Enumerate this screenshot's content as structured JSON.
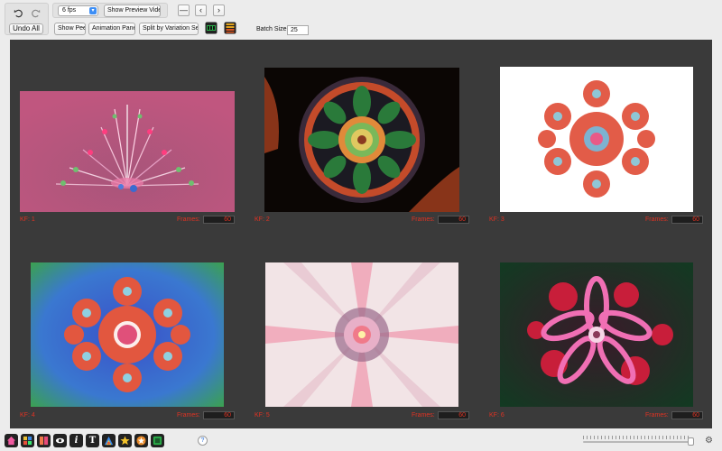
{
  "toolbar": {
    "undo_all_label": "Undo All",
    "fps_value": "6 fps",
    "show_preview_label": "Show Preview Video",
    "show_peer_label": "Show Peer",
    "animation_panel_label": "Animation Panel",
    "split_label": "Split by Variation Set",
    "batch_size_label": "Batch Size:",
    "batch_size_value": "25",
    "minus_glyph": "—",
    "prev_glyph": "‹",
    "next_glyph": "›",
    "icons": [
      "undo-icon",
      "redo-icon",
      "film-strip-icon",
      "film-stack-icon"
    ]
  },
  "keyframes": [
    {
      "kf_label": "KF: 1",
      "frames_label": "Frames:",
      "frames_value": "60",
      "style": "pink-fan"
    },
    {
      "kf_label": "KF: 2",
      "frames_label": "Frames:",
      "frames_value": "60",
      "style": "green-mandala"
    },
    {
      "kf_label": "KF: 3",
      "frames_label": "Frames:",
      "frames_value": "60",
      "style": "white-snowflake"
    },
    {
      "kf_label": "KF: 4",
      "frames_label": "Frames:",
      "frames_value": "60",
      "style": "blue-snowflake"
    },
    {
      "kf_label": "KF: 5",
      "frames_label": "Frames:",
      "frames_value": "60",
      "style": "pale-star"
    },
    {
      "kf_label": "KF: 6",
      "frames_label": "Frames:",
      "frames_value": "60",
      "style": "pink-flower"
    }
  ],
  "bottom": {
    "help_glyph": "?",
    "gear_glyph": "⚙",
    "zoom_fraction": 0.97,
    "tools": [
      "home-icon",
      "grid-icon",
      "split-view-icon",
      "eye-icon",
      "info-icon",
      "text-icon",
      "color-palette-icon",
      "star-icon",
      "star-badge-icon",
      "export-icon"
    ]
  }
}
